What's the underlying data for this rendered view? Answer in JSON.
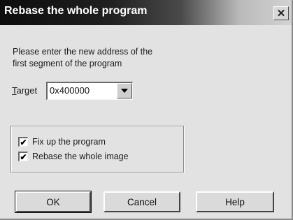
{
  "dialog": {
    "title": "Rebase the whole program",
    "close_glyph": "✕",
    "instructions": "Please enter the new address of the\nfirst segment of the program",
    "target": {
      "label_accel": "T",
      "label_rest": "arget",
      "value": "0x400000",
      "dropdown_icon": "chevron-down-icon"
    },
    "options": [
      {
        "label": "Fix up the program",
        "checked": true
      },
      {
        "label": "Rebase the whole image",
        "checked": true
      }
    ],
    "buttons": {
      "ok": "OK",
      "cancel": "Cancel",
      "help": "Help"
    },
    "check_glyph": "✔"
  }
}
